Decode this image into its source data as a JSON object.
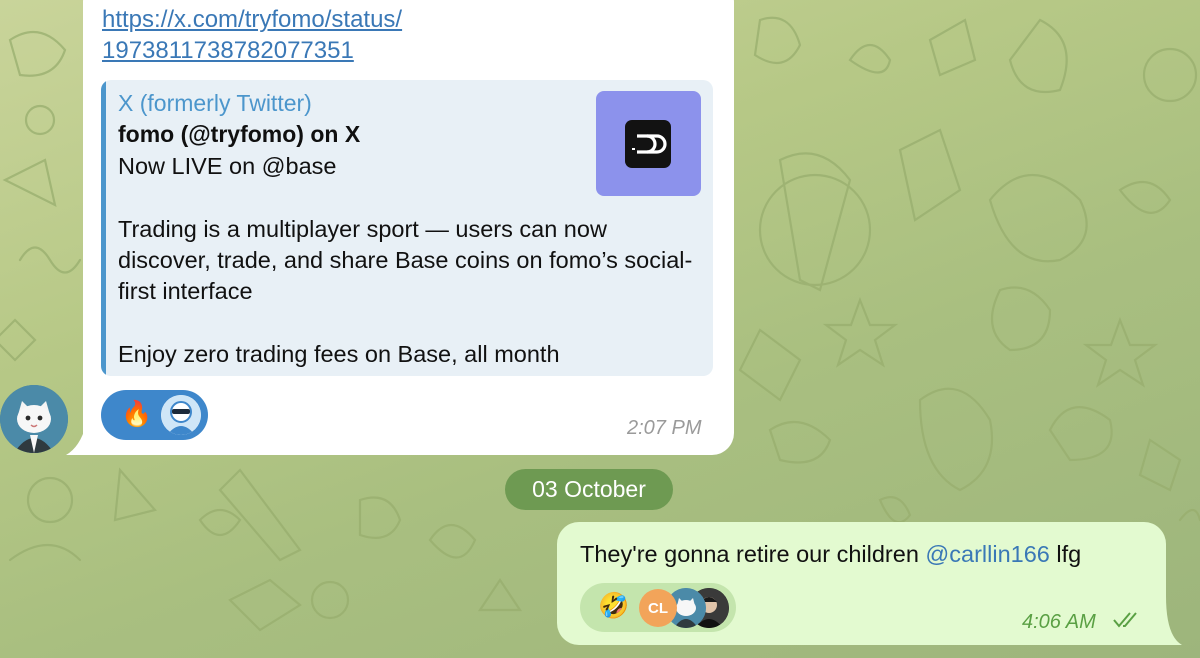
{
  "colors": {
    "incoming_bubble": "#ffffff",
    "outgoing_bubble": "#e3fad0",
    "link": "#3a78b6",
    "preview_accent": "#4c96cc",
    "date_pill": "#6e9a52",
    "time_outgoing": "#5aa044"
  },
  "incoming": {
    "link_line1": "https://x.com/tryfomo/status/",
    "link_line2": "1973811738782077351",
    "preview": {
      "site_name": "X (formerly Twitter)",
      "title": "fomo (@tryfomo) on X",
      "body": "Now LIVE on @base\n\nTrading is a multiplayer sport — users can now discover, trade, and share Base coins on fomo’s social-first interface\n\nEnjoy zero trading fees on Base, all month",
      "thumbnail_icon": "fomo-logo-icon"
    },
    "reactions": [
      {
        "emoji": "🔥",
        "icon": "fire-emoji"
      },
      {
        "icon": "reactor-avatar-icon"
      }
    ],
    "time": "2:07 PM",
    "sender_avatar_icon": "cat-avatar-icon"
  },
  "date_separator": "03 October",
  "outgoing": {
    "text_before": "They're gonna retire our children ",
    "mention": "@carllin166",
    "text_after": " lfg",
    "reactions": {
      "emoji": "🤣",
      "icon": "rofl-emoji",
      "avatars": [
        "CL",
        "cat-avatar-icon",
        "person-avatar-icon"
      ]
    },
    "time": "4:06 AM",
    "status_icon": "double-check-icon"
  }
}
